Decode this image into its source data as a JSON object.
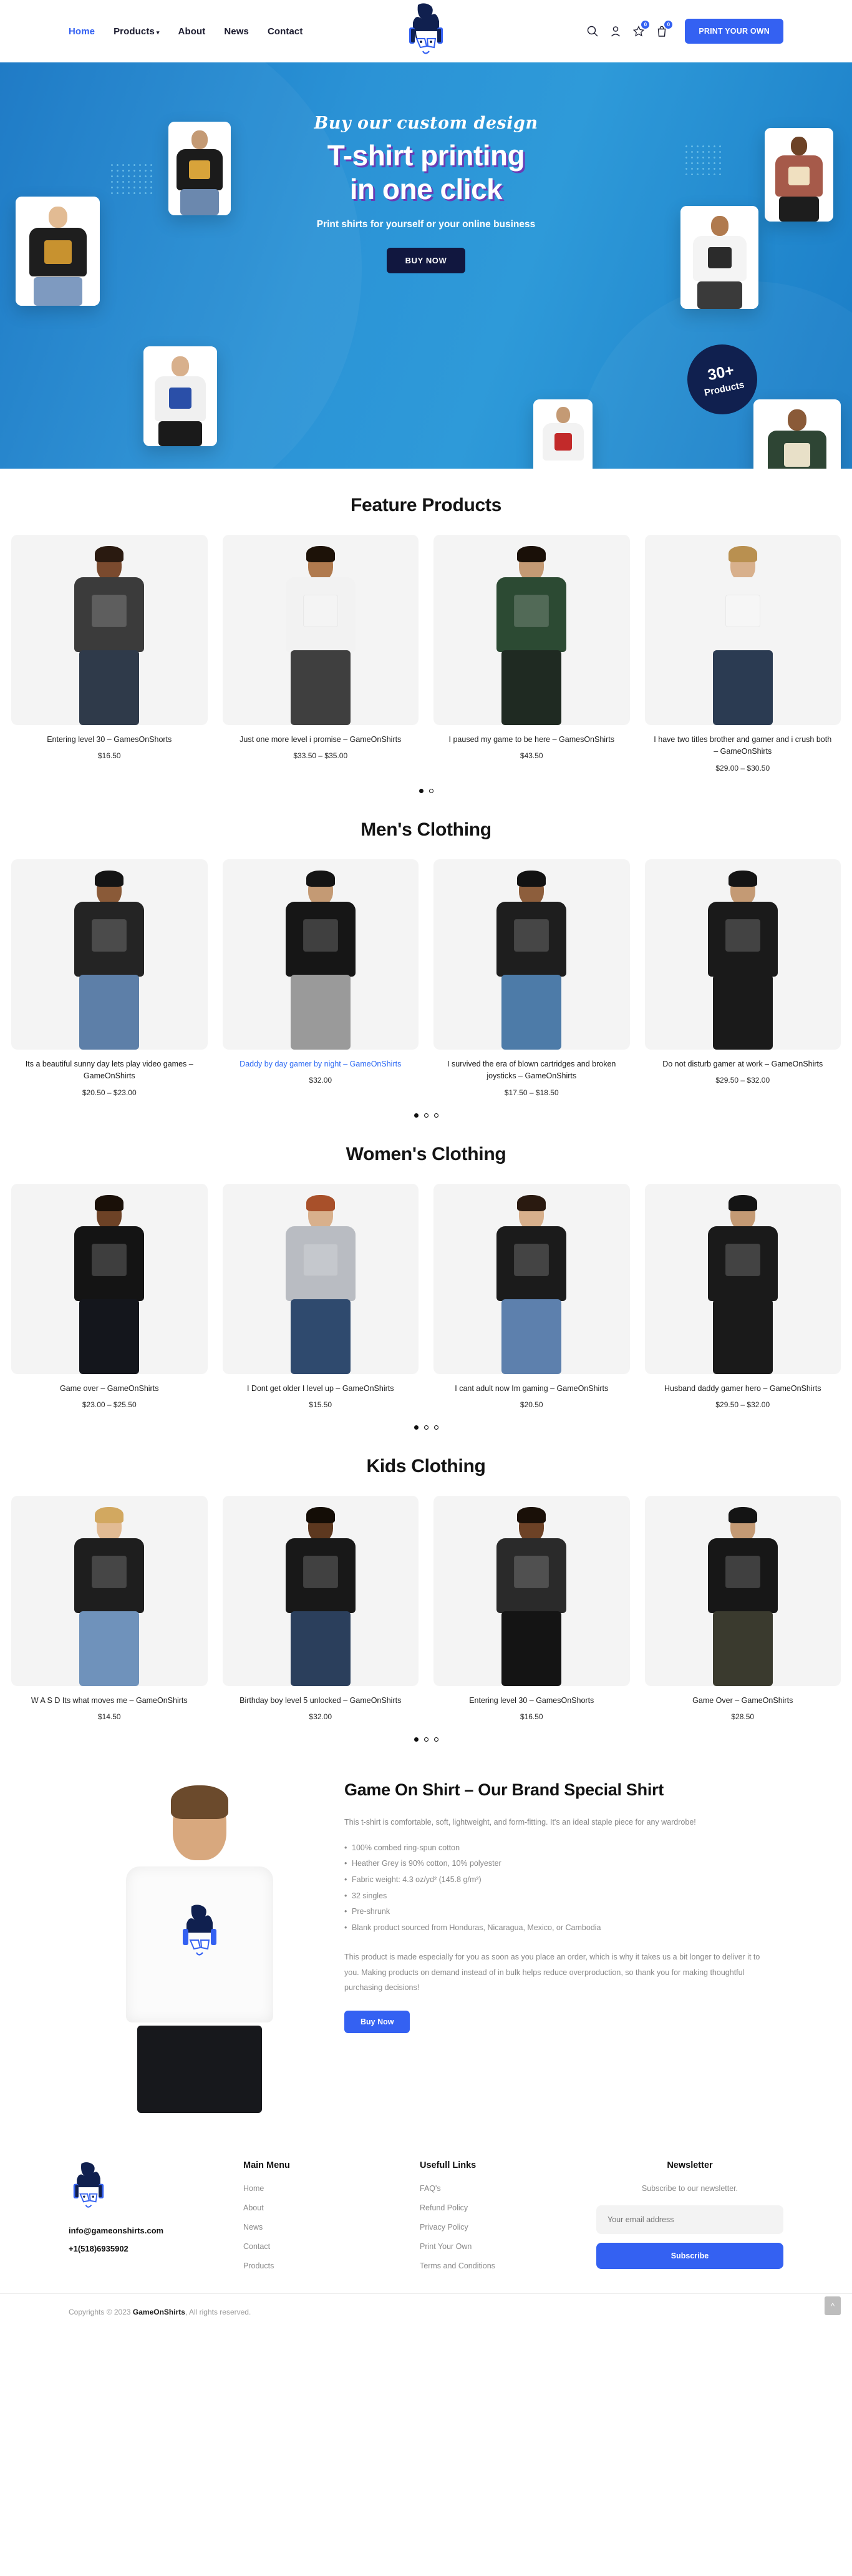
{
  "header": {
    "nav": [
      {
        "label": "Home",
        "active": true,
        "caret": false
      },
      {
        "label": "Products",
        "active": false,
        "caret": true
      },
      {
        "label": "About",
        "active": false,
        "caret": false
      },
      {
        "label": "News",
        "active": false,
        "caret": false
      },
      {
        "label": "Contact",
        "active": false,
        "caret": false
      }
    ],
    "icons": {
      "search": "search-icon",
      "account": "user-icon",
      "wishlist": "star-icon",
      "cart": "bag-icon"
    },
    "wishlist_count": "0",
    "cart_count": "0",
    "cta_label": "PRINT YOUR OWN",
    "accent": "#3461f2"
  },
  "hero": {
    "script_line": "Buy our custom design",
    "title_line1": "T-shirt printing",
    "title_line2": "in one click",
    "subtitle": "Print shirts for yourself or your online business",
    "cta_label": "BUY NOW",
    "badge_number": "30+",
    "badge_label": "Products",
    "badge_color": "#10204f",
    "bg_color": "#2b93d6"
  },
  "sections": [
    {
      "title": "Feature Products",
      "dots": [
        true,
        false
      ],
      "products": [
        {
          "title": "Entering level 30 – GamesOnShorts",
          "price": "$16.50",
          "highlight": false,
          "shirt": "#3b3b3b",
          "skin": "#7a4a2e",
          "hair": "#2a1a10",
          "pants": "#2f3a4a"
        },
        {
          "title": "Just one more level i promise – GameOnShirts",
          "price": "$33.50 – $35.00",
          "highlight": false,
          "shirt": "#f2f2f2",
          "skin": "#b07a4e",
          "hair": "#1d1208",
          "pants": "#3f3f3f"
        },
        {
          "title": "I paused my game to be here – GamesOnShirts",
          "price": "$43.50",
          "highlight": false,
          "shirt": "#2c4a33",
          "skin": "#c49a74",
          "hair": "#1a1008",
          "pants": "#1f2a22"
        },
        {
          "title": "I have two titles brother and gamer and i crush both – GameOnShirts",
          "price": "$29.00 – $30.50",
          "highlight": false,
          "shirt": "#f4f4f4",
          "skin": "#d8b08c",
          "hair": "#b99050",
          "pants": "#2b3b52"
        }
      ]
    },
    {
      "title": "Men's Clothing",
      "dots": [
        true,
        false,
        false
      ],
      "products": [
        {
          "title": "Its a beautiful sunny day lets play video games – GameOnShirts",
          "price": "$20.50 – $23.00",
          "highlight": false,
          "shirt": "#242424",
          "skin": "#8a5a38",
          "hair": "#141414",
          "pants": "#5d7fa8"
        },
        {
          "title": "Daddy by day gamer by night – GameOnShirts",
          "price": "$32.00",
          "highlight": true,
          "shirt": "#161616",
          "skin": "#c49a74",
          "hair": "#141414",
          "pants": "#9a9a9a"
        },
        {
          "title": "I survived the era of blown cartridges and broken joysticks – GameOnShirts",
          "price": "$17.50 – $18.50",
          "highlight": false,
          "shirt": "#1e1e1e",
          "skin": "#8d5e3c",
          "hair": "#121212",
          "pants": "#4d7ba8"
        },
        {
          "title": "Do not disturb gamer at work – GameOnShirts",
          "price": "$29.50 – $32.00",
          "highlight": false,
          "shirt": "#1a1a1a",
          "skin": "#c49a74",
          "hair": "#141414",
          "pants": "#1a1a1a"
        }
      ]
    },
    {
      "title": "Women's Clothing",
      "dots": [
        true,
        false,
        false
      ],
      "products": [
        {
          "title": "Game over – GameOnShirts",
          "price": "$23.00 – $25.50",
          "highlight": false,
          "shirt": "#141414",
          "skin": "#6d4226",
          "hair": "#1a1008",
          "pants": "#14161c"
        },
        {
          "title": "I Dont get older I level up – GameOnShirts",
          "price": "$15.50",
          "highlight": false,
          "shirt": "#b9bcc2",
          "skin": "#d8b08c",
          "hair": "#a8502a",
          "pants": "#2f4a6e"
        },
        {
          "title": "I cant adult now Im gaming – GameOnShirts",
          "price": "$20.50",
          "highlight": false,
          "shirt": "#1b1b1b",
          "skin": "#d8b08c",
          "hair": "#2a1a10",
          "pants": "#5d80ad"
        },
        {
          "title": "Husband daddy gamer hero – GameOnShirts",
          "price": "$29.50 – $32.00",
          "highlight": false,
          "shirt": "#1a1a1a",
          "skin": "#c49a74",
          "hair": "#141414",
          "pants": "#1a1a1a"
        }
      ]
    },
    {
      "title": "Kids Clothing",
      "dots": [
        true,
        false,
        false
      ],
      "products": [
        {
          "title": "W A S D Its what moves me – GameOnShirts",
          "price": "$14.50",
          "highlight": false,
          "shirt": "#1e1e1e",
          "skin": "#e2bb93",
          "hair": "#d2a860",
          "pants": "#6f92bb"
        },
        {
          "title": "Birthday boy level 5 unlocked – GameOnShirts",
          "price": "$32.00",
          "highlight": false,
          "shirt": "#181818",
          "skin": "#5d381f",
          "hair": "#140d06",
          "pants": "#2b3f5c"
        },
        {
          "title": "Entering level 30 – GamesOnShorts",
          "price": "$16.50",
          "highlight": false,
          "shirt": "#2a2a2a",
          "skin": "#6d4226",
          "hair": "#1a1008",
          "pants": "#141414"
        },
        {
          "title": "Game Over – GameOnShirts",
          "price": "$28.50",
          "highlight": false,
          "shirt": "#171717",
          "skin": "#c49a74",
          "hair": "#141414",
          "pants": "#3a3a2e"
        }
      ]
    }
  ],
  "brand": {
    "title": "Game On Shirt – Our Brand Special Shirt",
    "intro": "This t-shirt is comfortable, soft, lightweight, and form-fitting. It's an ideal staple piece for any wardrobe!",
    "bullets": [
      "100% combed ring-spun cotton",
      "Heather Grey is 90% cotton, 10% polyester",
      "Fabric weight: 4.3 oz/yd² (145.8 g/m²)",
      "32 singles",
      "Pre-shrunk",
      "Blank product sourced from Honduras, Nicaragua, Mexico, or Cambodia"
    ],
    "outro": "This product is made especially for you as soon as you place an order, which is why it takes us a bit longer to deliver it to you. Making products on demand instead of in bulk helps reduce overproduction, so thank you for making thoughtful purchasing decisions!",
    "cta_label": "Buy Now"
  },
  "footer": {
    "email": "info@gameonshirts.com",
    "phone": "+1(518)6935902",
    "main_menu": {
      "heading": "Main Menu",
      "links": [
        "Home",
        "About",
        "News",
        "Contact",
        "Products"
      ]
    },
    "useful_links": {
      "heading": "Usefull Links",
      "links": [
        "FAQ's",
        "Refund Policy",
        "Privacy Policy",
        "Print Your Own",
        "Terms and Conditions"
      ]
    },
    "newsletter": {
      "heading": "Newsletter",
      "subtitle": "Subscribe to our newsletter.",
      "placeholder": "Your email address",
      "input_value": "",
      "button_label": "Subscribe"
    },
    "copyright_prefix": "Copyrights © 2023 ",
    "copyright_brand": "GameOnShirts",
    "copyright_suffix": ", All rights reserved.",
    "to_top_icon": "chevron-up-icon"
  }
}
